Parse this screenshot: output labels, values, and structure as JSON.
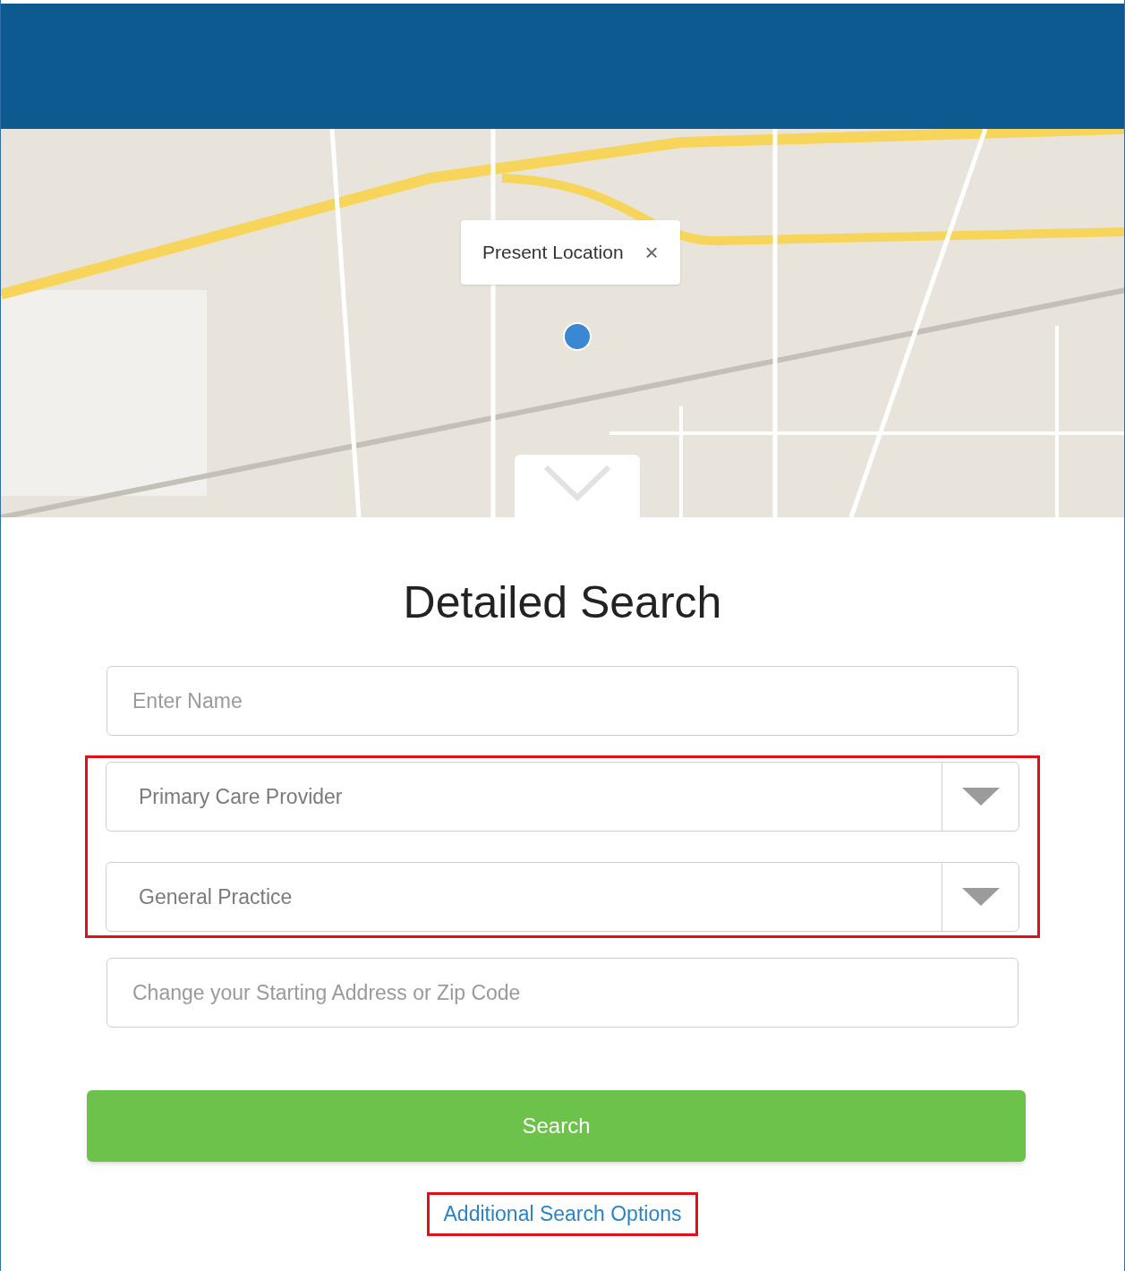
{
  "map": {
    "popup": {
      "label": "Present Location",
      "close": "×"
    }
  },
  "title": "Detailed Search",
  "fields": [
    {
      "kind": "input",
      "placeholder": "Enter Name",
      "highlighted": false
    },
    {
      "kind": "select",
      "value": "Primary Care Provider",
      "highlighted": true
    },
    {
      "kind": "select",
      "value": "General Practice",
      "highlighted": true
    },
    {
      "kind": "input",
      "placeholder": "Change your Starting Address or Zip Code",
      "highlighted": false
    }
  ],
  "search_button": "Search",
  "link": {
    "label": "Additional Search Options",
    "highlighted": true
  }
}
